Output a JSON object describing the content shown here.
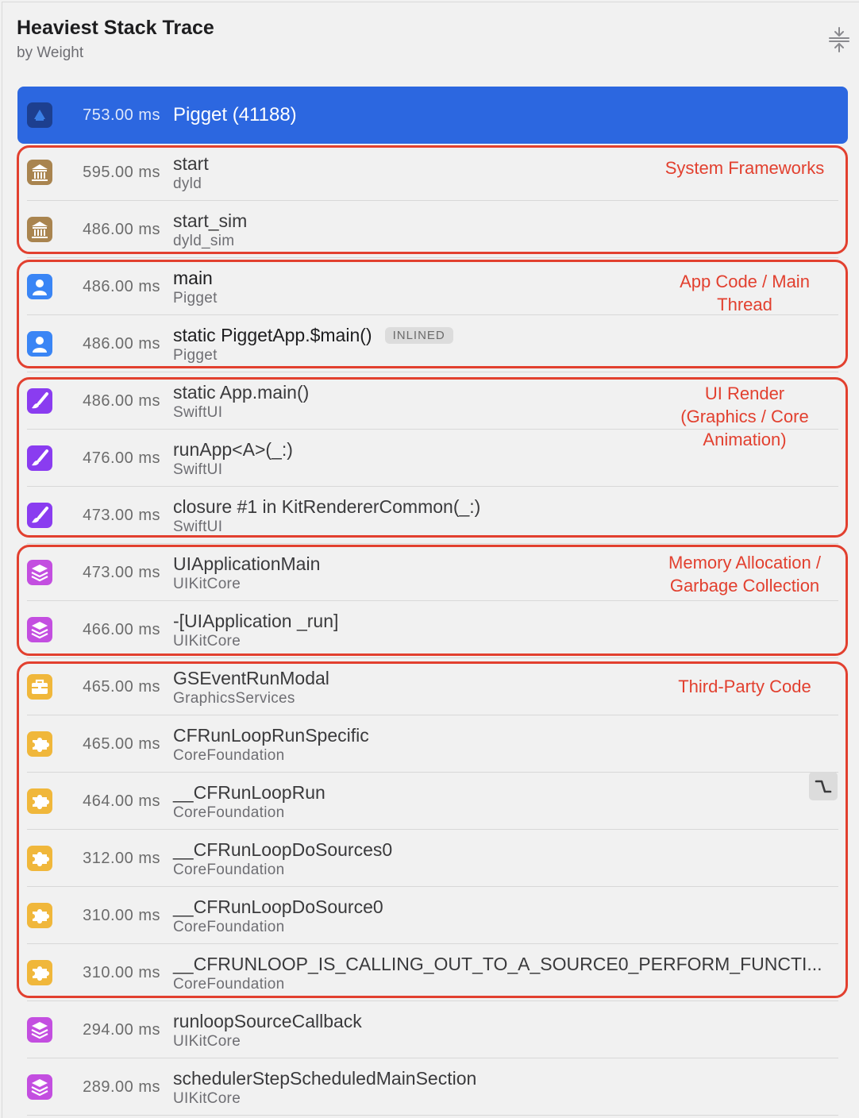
{
  "header": {
    "title": "Heaviest Stack Trace",
    "subtitle": "by Weight"
  },
  "colors": {
    "selected": "#2c67e0",
    "annotation": "#e2402f",
    "system": "#a9844f",
    "app": "#3a85f5",
    "swiftui": "#8a3cf0",
    "uikit": "#c34ee0",
    "third_party": "#f0b73b"
  },
  "frames": [
    {
      "weight": "753.00 ms",
      "name": "Pigget (41188)",
      "library": "",
      "icon": "app-process-icon",
      "selected": true
    },
    {
      "weight": "595.00 ms",
      "name": "start",
      "library": "dyld",
      "icon": "system-library-icon"
    },
    {
      "weight": "486.00 ms",
      "name": "start_sim",
      "library": "dyld_sim",
      "icon": "system-library-icon"
    },
    {
      "weight": "486.00 ms",
      "name": "main",
      "library": "Pigget",
      "icon": "user-code-icon"
    },
    {
      "weight": "486.00 ms",
      "name": "static PiggetApp.$main()",
      "library": "Pigget",
      "icon": "user-code-icon",
      "badge": "INLINED"
    },
    {
      "weight": "486.00 ms",
      "name": "static App.main()",
      "library": "SwiftUI",
      "icon": "paintbrush-icon"
    },
    {
      "weight": "476.00 ms",
      "name": "runApp<A>(_:)",
      "library": "SwiftUI",
      "icon": "paintbrush-icon"
    },
    {
      "weight": "473.00 ms",
      "name": "closure #1 in KitRendererCommon(_:)",
      "library": "SwiftUI",
      "icon": "paintbrush-icon"
    },
    {
      "weight": "473.00 ms",
      "name": "UIApplicationMain",
      "library": "UIKitCore",
      "icon": "layers-icon"
    },
    {
      "weight": "466.00 ms",
      "name": "-[UIApplication _run]",
      "library": "UIKitCore",
      "icon": "layers-icon"
    },
    {
      "weight": "465.00 ms",
      "name": "GSEventRunModal",
      "library": "GraphicsServices",
      "icon": "toolbox-icon"
    },
    {
      "weight": "465.00 ms",
      "name": "CFRunLoopRunSpecific",
      "library": "CoreFoundation",
      "icon": "puzzle-icon"
    },
    {
      "weight": "464.00 ms",
      "name": "__CFRunLoopRun",
      "library": "CoreFoundation",
      "icon": "puzzle-icon"
    },
    {
      "weight": "312.00 ms",
      "name": "__CFRunLoopDoSources0",
      "library": "CoreFoundation",
      "icon": "puzzle-icon"
    },
    {
      "weight": "310.00 ms",
      "name": "__CFRunLoopDoSource0",
      "library": "CoreFoundation",
      "icon": "puzzle-icon"
    },
    {
      "weight": "310.00 ms",
      "name": "__CFRUNLOOP_IS_CALLING_OUT_TO_A_SOURCE0_PERFORM_FUNCTI...",
      "library": "CoreFoundation",
      "icon": "puzzle-icon"
    },
    {
      "weight": "294.00 ms",
      "name": "runloopSourceCallback",
      "library": "UIKitCore",
      "icon": "layers-icon"
    },
    {
      "weight": "289.00 ms",
      "name": "schedulerStepScheduledMainSection",
      "library": "UIKitCore",
      "icon": "layers-icon"
    }
  ],
  "annotations": [
    {
      "label_lines": [
        "System Frameworks"
      ]
    },
    {
      "label_lines": [
        "App Code / Main",
        "Thread"
      ]
    },
    {
      "label_lines": [
        "UI Render",
        "(Graphics / Core",
        "Animation)"
      ]
    },
    {
      "label_lines": [
        "Memory Allocation /",
        "Garbage Collection"
      ]
    },
    {
      "label_lines": [
        "Third-Party Code"
      ]
    }
  ]
}
